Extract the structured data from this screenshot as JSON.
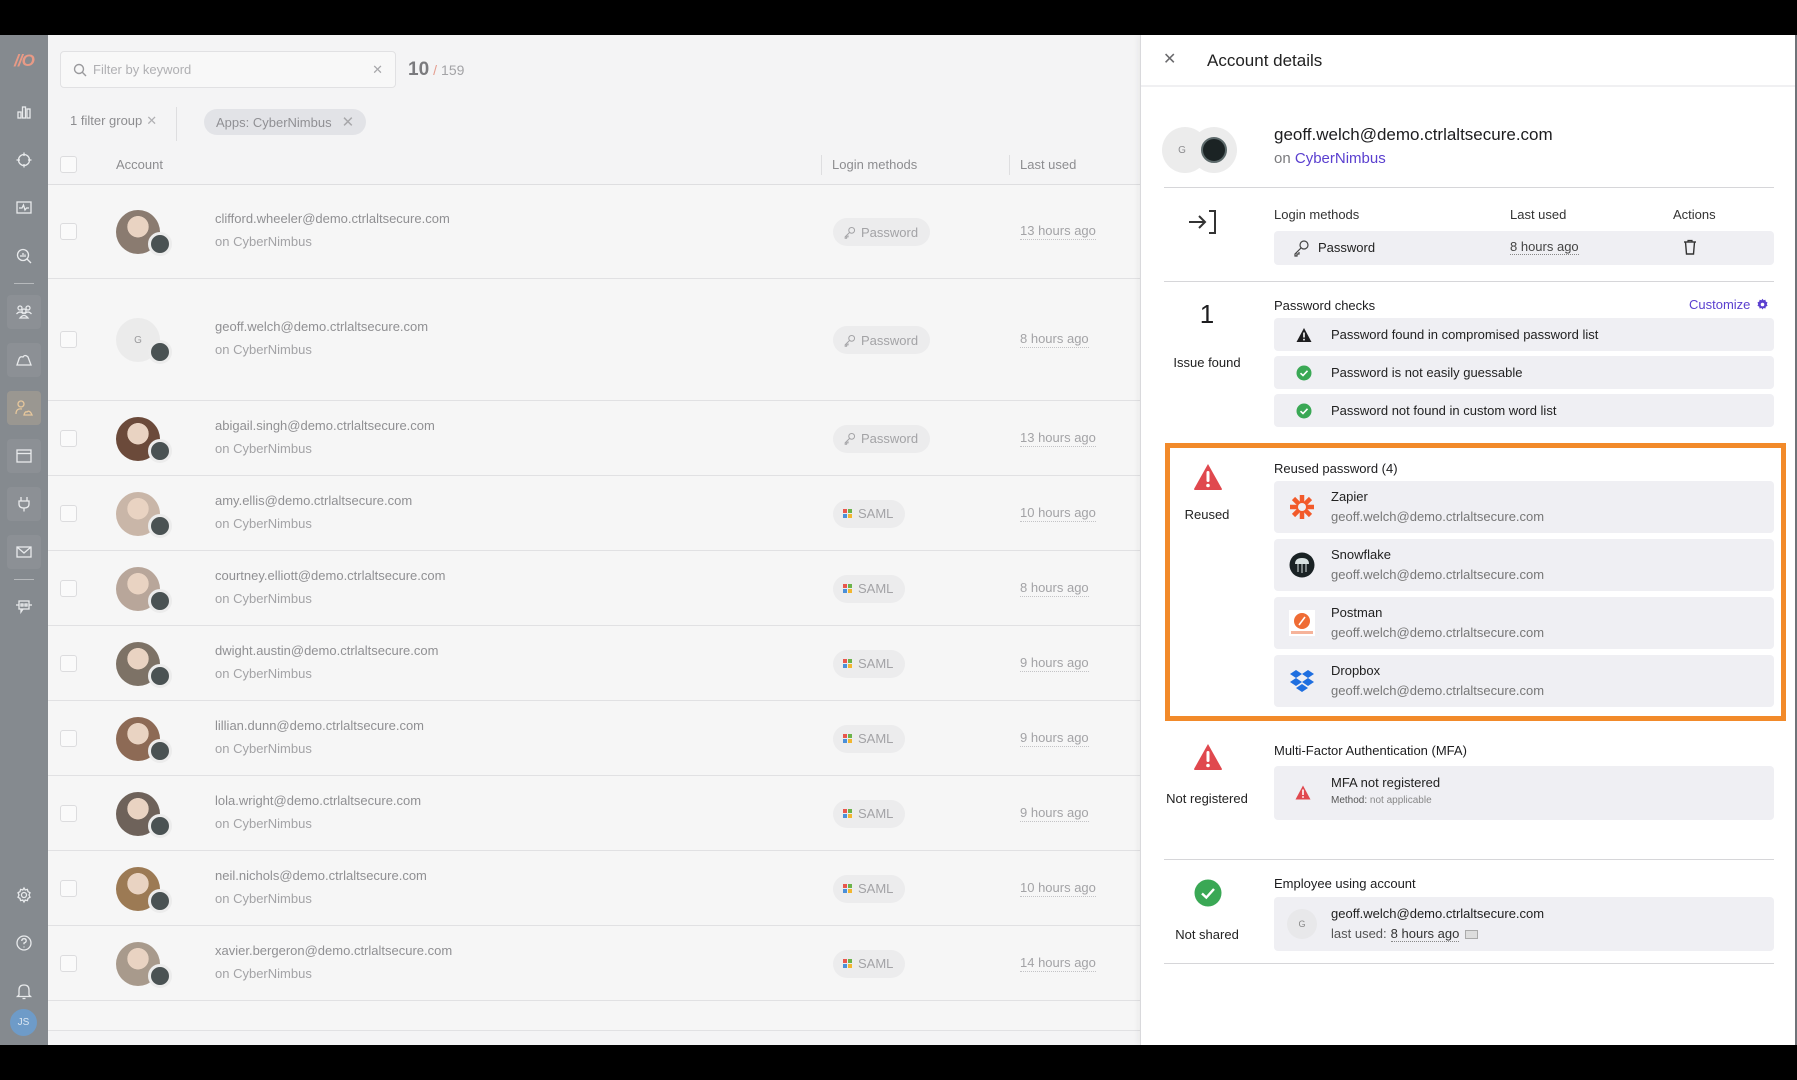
{
  "sidebar": {
    "logo_text": "//O",
    "items": [
      {
        "name": "dashboard",
        "icon": "bar-chart-icon"
      },
      {
        "name": "targets",
        "icon": "crosshair-icon"
      },
      {
        "name": "monitoring",
        "icon": "activity-monitor-icon"
      },
      {
        "name": "analytics",
        "icon": "search-chart-icon"
      },
      {
        "name": "employees",
        "icon": "users-icon"
      },
      {
        "name": "cloud-apps",
        "icon": "cloud-icon"
      },
      {
        "name": "accounts",
        "icon": "user-cloud-icon",
        "active": true
      },
      {
        "name": "browser",
        "icon": "browser-window-icon"
      },
      {
        "name": "integrations",
        "icon": "plug-icon"
      },
      {
        "name": "email",
        "icon": "mail-icon"
      },
      {
        "name": "bot",
        "icon": "robot-chat-icon"
      }
    ],
    "bottom": [
      {
        "name": "settings",
        "icon": "gear-icon"
      },
      {
        "name": "help",
        "icon": "question-circle-icon"
      },
      {
        "name": "notifications",
        "icon": "bell-icon"
      }
    ],
    "user_initials": "JS"
  },
  "list": {
    "search_placeholder": "Filter by keyword",
    "count_shown": "10",
    "count_sep": "/",
    "count_total": "159",
    "filter_group_label": "1 filter group",
    "filter_chip": "Apps: CyberNimbus",
    "columns": {
      "account": "Account",
      "login_methods": "Login methods",
      "last_used": "Last used"
    },
    "rows": [
      {
        "email": "clifford.wheeler@demo.ctrlaltsecure.com",
        "app": "on CyberNimbus",
        "method": "Password",
        "method_type": "password",
        "last_used": "13 hours ago",
        "avatar": "photo"
      },
      {
        "email": "geoff.welch@demo.ctrlaltsecure.com",
        "app": "on CyberNimbus",
        "method": "Password",
        "method_type": "password",
        "last_used": "8 hours ago",
        "avatar": "G"
      },
      {
        "email": "abigail.singh@demo.ctrlaltsecure.com",
        "app": "on CyberNimbus",
        "method": "Password",
        "method_type": "password",
        "last_used": "13 hours ago",
        "avatar": "photo"
      },
      {
        "email": "amy.ellis@demo.ctrlaltsecure.com",
        "app": "on CyberNimbus",
        "method": "SAML",
        "method_type": "saml",
        "last_used": "10 hours ago",
        "avatar": "photo"
      },
      {
        "email": "courtney.elliott@demo.ctrlaltsecure.com",
        "app": "on CyberNimbus",
        "method": "SAML",
        "method_type": "saml",
        "last_used": "8 hours ago",
        "avatar": "photo"
      },
      {
        "email": "dwight.austin@demo.ctrlaltsecure.com",
        "app": "on CyberNimbus",
        "method": "SAML",
        "method_type": "saml",
        "last_used": "9 hours ago",
        "avatar": "photo"
      },
      {
        "email": "lillian.dunn@demo.ctrlaltsecure.com",
        "app": "on CyberNimbus",
        "method": "SAML",
        "method_type": "saml",
        "last_used": "9 hours ago",
        "avatar": "photo"
      },
      {
        "email": "lola.wright@demo.ctrlaltsecure.com",
        "app": "on CyberNimbus",
        "method": "SAML",
        "method_type": "saml",
        "last_used": "9 hours ago",
        "avatar": "photo"
      },
      {
        "email": "neil.nichols@demo.ctrlaltsecure.com",
        "app": "on CyberNimbus",
        "method": "SAML",
        "method_type": "saml",
        "last_used": "10 hours ago",
        "avatar": "photo"
      },
      {
        "email": "xavier.bergeron@demo.ctrlaltsecure.com",
        "app": "on CyberNimbus",
        "method": "SAML",
        "method_type": "saml",
        "last_used": "14 hours ago",
        "avatar": "photo"
      }
    ]
  },
  "panel": {
    "title": "Account details",
    "account": {
      "initial": "G",
      "email": "geoff.welch@demo.ctrlaltsecure.com",
      "on_prefix": "on",
      "app": "CyberNimbus"
    },
    "login_methods": {
      "headers": {
        "method": "Login methods",
        "last_used": "Last used",
        "actions": "Actions"
      },
      "rows": [
        {
          "method": "Password",
          "last_used": "8 hours ago"
        }
      ]
    },
    "password_checks": {
      "count": "1",
      "count_label": "Issue found",
      "title": "Password checks",
      "customize": "Customize",
      "items": [
        {
          "status": "warning",
          "text": "Password found in compromised password list"
        },
        {
          "status": "ok",
          "text": "Password is not easily guessable"
        },
        {
          "status": "ok",
          "text": "Password not found in custom word list"
        }
      ]
    },
    "reused": {
      "status_label": "Reused",
      "title": "Reused password (4)",
      "highlight_color": "#f28a2a",
      "items": [
        {
          "app": "Zapier",
          "email": "geoff.welch@demo.ctrlaltsecure.com",
          "icon": "zapier-icon"
        },
        {
          "app": "Snowflake",
          "email": "geoff.welch@demo.ctrlaltsecure.com",
          "icon": "snowflake-icon"
        },
        {
          "app": "Postman",
          "email": "geoff.welch@demo.ctrlaltsecure.com",
          "icon": "postman-icon"
        },
        {
          "app": "Dropbox",
          "email": "geoff.welch@demo.ctrlaltsecure.com",
          "icon": "dropbox-icon"
        }
      ]
    },
    "mfa": {
      "status_label": "Not registered",
      "title": "Multi-Factor Authentication (MFA)",
      "item_title": "MFA not registered",
      "method_label": "Method:",
      "method_value": "not applicable"
    },
    "employee": {
      "status_label": "Not shared",
      "title": "Employee using account",
      "initial": "G",
      "email": "geoff.welch@demo.ctrlaltsecure.com",
      "last_used_label": "last used:",
      "last_used": "8 hours ago"
    }
  },
  "colors": {
    "accent": "#5a3fcf",
    "danger": "#e0484e",
    "success": "#3aa855",
    "highlight": "#f28a2a"
  }
}
